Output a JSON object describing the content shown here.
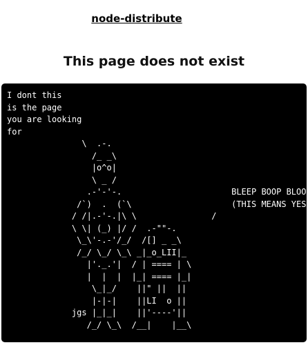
{
  "header": {
    "site_link": "node-distribute"
  },
  "main": {
    "title": "This page does not exist",
    "ascii_art": "I dont this\nis the page\nyou are looking\nfor\n               \\  .-.\n                 /_ _\\\n                 |o^o|\n                 \\ _ /\n                .-'-'-.                      BLEEP BOOP BLOOP\n              /`)  .  (`\\                    (THIS MEANS YES)\n             / /|.-'-.|\\ \\               /\n             \\ \\| (_) |/ /  .-\"\"-.\n              \\_\\'-.-'/_/  /[] _ _\\\n              /_/ \\_/ \\_\\ _|_o_LII|_\n                |'._.'|  / | ==== | \\\n                |  |  |  |_| ==== |_|\n                 \\_|_/    ||\" ||  ||\n                 |-|-|    ||LI  o ||\n             jgs |_|_|    ||'----'||\n                /_/ \\_\\  /__|    |__\\"
  }
}
